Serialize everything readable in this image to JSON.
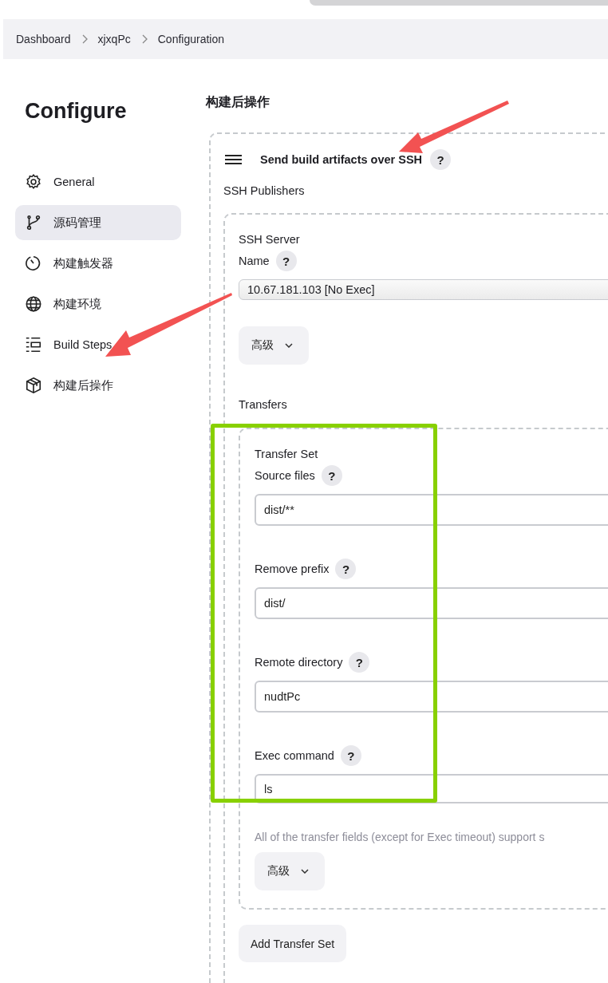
{
  "breadcrumbs": [
    "Dashboard",
    "xjxqPc",
    "Configuration"
  ],
  "sidebar": {
    "title": "Configure",
    "items": [
      {
        "label": "General",
        "selected": false
      },
      {
        "label": "源码管理",
        "selected": true
      },
      {
        "label": "构建触发器",
        "selected": false
      },
      {
        "label": "构建环境",
        "selected": false
      },
      {
        "label": "Build Steps",
        "selected": false
      },
      {
        "label": "构建后操作",
        "selected": false
      }
    ]
  },
  "section": {
    "title": "构建后操作",
    "step": {
      "title": "Send build artifacts over SSH",
      "help": "?",
      "publishers_label": "SSH Publishers",
      "server": {
        "heading": "SSH Server",
        "name_label": "Name",
        "name_help": "?",
        "name_value": "10.67.181.103 [No Exec]",
        "advanced": "高级"
      },
      "transfers_label": "Transfers",
      "transfer_set": {
        "heading": "Transfer Set",
        "fields": [
          {
            "label": "Source files",
            "help": "?",
            "value": "dist/**"
          },
          {
            "label": "Remove prefix",
            "help": "?",
            "value": "dist/"
          },
          {
            "label": "Remote directory",
            "help": "?",
            "value": "nudtPc"
          },
          {
            "label": "Exec command",
            "help": "?",
            "value": "ls"
          }
        ],
        "note": "All of the transfer fields (except for Exec timeout) support s",
        "advanced": "高级"
      },
      "add_button": "Add Transfer Set"
    }
  }
}
